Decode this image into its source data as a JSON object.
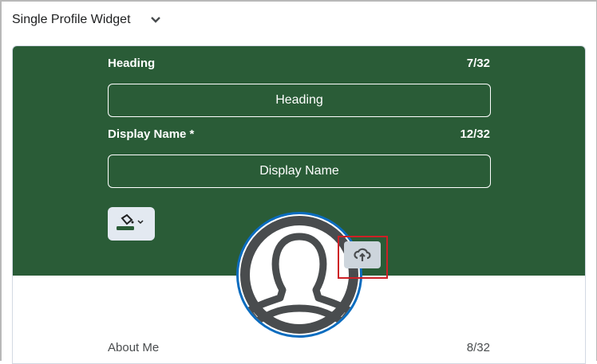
{
  "widget": {
    "title": "Single Profile Widget"
  },
  "heading": {
    "label": "Heading",
    "count": "7/32",
    "value": "Heading"
  },
  "display_name": {
    "label": "Display Name *",
    "count": "12/32",
    "value": "Display Name"
  },
  "about": {
    "label": "About Me",
    "count": "8/32"
  },
  "colors": {
    "banner": "#2a5c37",
    "avatar_ring": "#0b6cbf",
    "highlight": "#cd2026"
  }
}
